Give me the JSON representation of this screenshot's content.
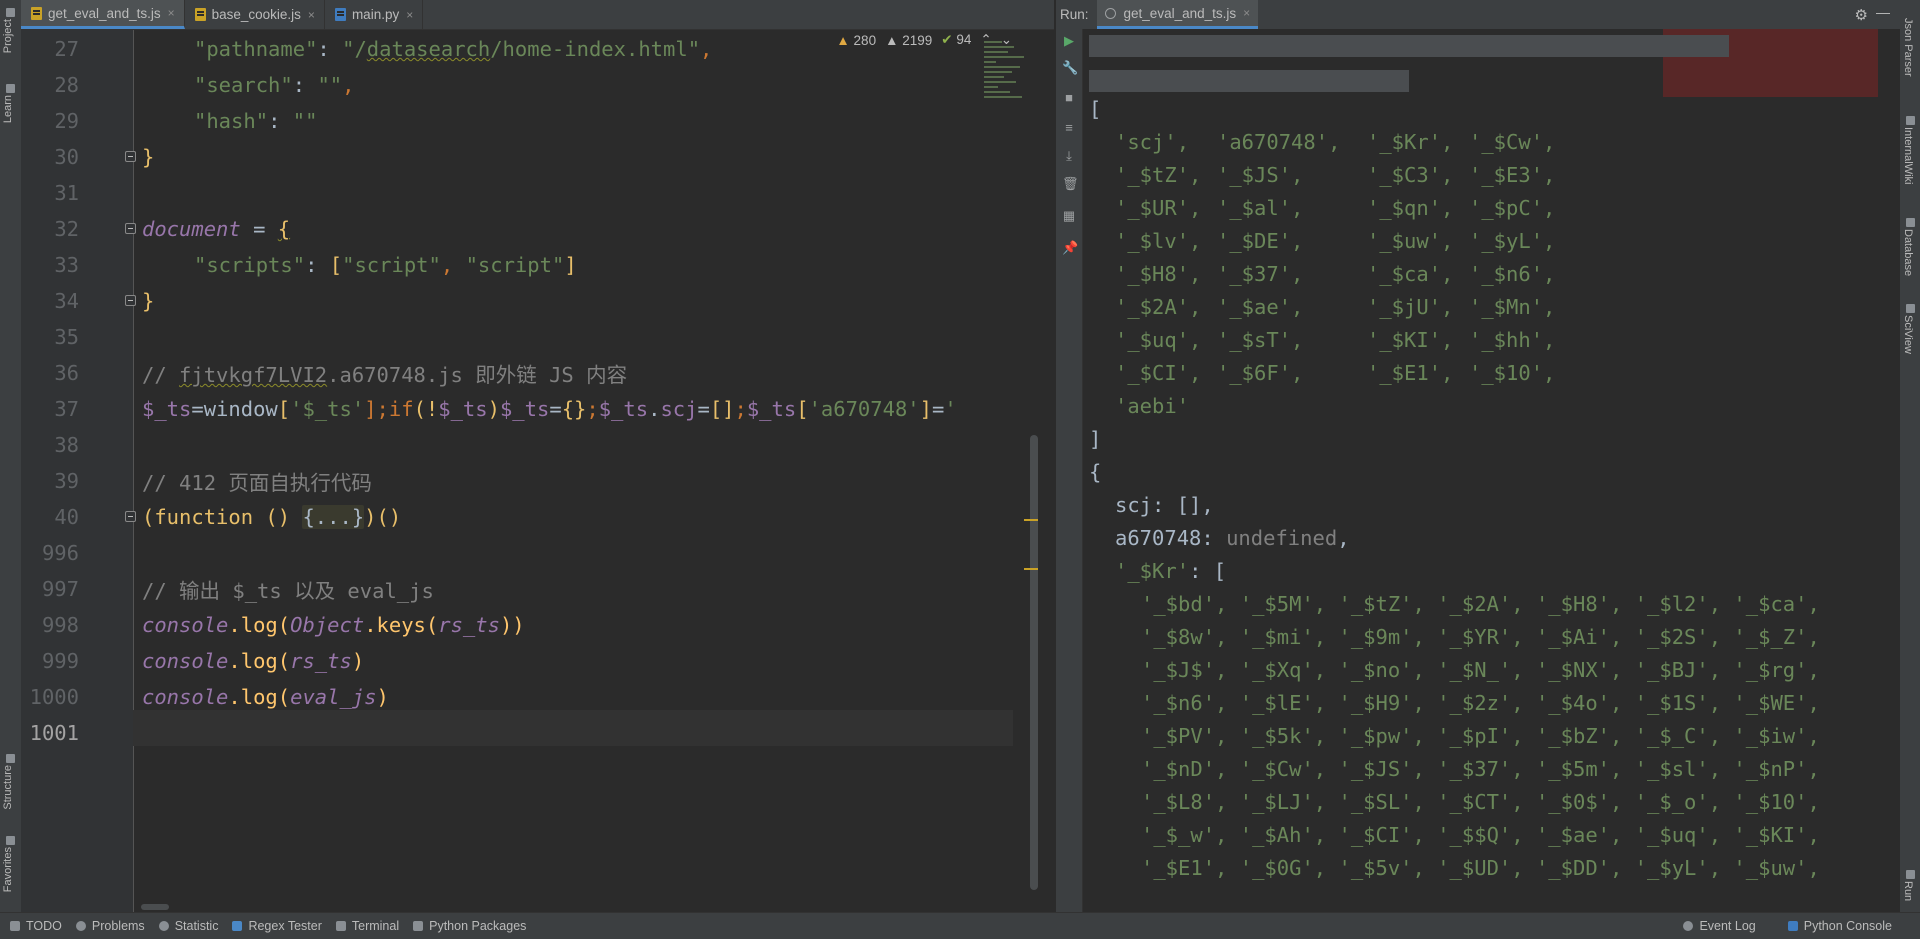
{
  "left_strip": {
    "project": "Project",
    "learn": "Learn",
    "structure": "Structure",
    "favorites": "Favorites"
  },
  "right_strip": {
    "json_parser": "Json Parser",
    "internal_wiki": "InternalWiki",
    "database": "Database",
    "sciview": "SciView",
    "run": "Run"
  },
  "editor_tabs": [
    {
      "label": "get_eval_and_ts.js",
      "icon": "js-file-icon",
      "active": true
    },
    {
      "label": "base_cookie.js",
      "icon": "js-file-icon",
      "active": false
    },
    {
      "label": "main.py",
      "icon": "python-file-icon",
      "active": false
    }
  ],
  "inspections": {
    "warnings": "280",
    "weak_warnings": "2199",
    "typos": "94",
    "up": "⌃",
    "down": "⌄"
  },
  "gutter": {
    "l27": "27",
    "l28": "28",
    "l29": "29",
    "l30": "30",
    "l31": "31",
    "l32": "32",
    "l33": "33",
    "l34": "34",
    "l35": "35",
    "l36": "36",
    "l37": "37",
    "l38": "38",
    "l39": "39",
    "l40": "40",
    "l996": "996",
    "l997": "997",
    "l998": "998",
    "l999": "999",
    "l1000": "1000",
    "l1001": "1001"
  },
  "code": {
    "l27_key": "\"pathname\"",
    "l27_colon": ": ",
    "l27_q1": "\"",
    "l27_path1": "/",
    "l27_path_word": "datasearch",
    "l27_path2": "/home-index.html\"",
    "l27_comma": ",",
    "l28_key": "\"search\"",
    "l28_rest": ": ",
    "l28_val": "\"\"",
    "l28_comma": ",",
    "l29_key": "\"hash\"",
    "l29_rest": ": ",
    "l29_val": "\"\"",
    "l30": "}",
    "l32_doc": "document",
    "l32_eq": " = ",
    "l32_brace": "{",
    "l33_key": "\"scripts\"",
    "l33_colon": ": ",
    "l33_open": "[",
    "l33_s1": "\"script\"",
    "l33_sep": ", ",
    "l33_s2": "\"script\"",
    "l33_close": "]",
    "l34": "}",
    "l36_a": "// ",
    "l36_b": "fjtvkgf7LVI2",
    "l36_c": ".a670748.js 即外链 JS 内容",
    "l37_a": "$_ts",
    "l37_b": "=window",
    "l37_c": "[",
    "l37_d": "'$_ts'",
    "l37_e": "];",
    "l37_f": "if",
    "l37_g": "(!",
    "l37_h": "$_ts",
    "l37_i": ")",
    "l37_j": "$_ts",
    "l37_k": "=",
    "l37_l": "{}",
    "l37_m": ";",
    "l37_n": "$_ts",
    "l37_o": ".",
    "l37_p": "scj",
    "l37_q": "=",
    "l37_r": "[]",
    "l37_s": ";",
    "l37_t": "$_ts",
    "l37_u": "[",
    "l37_v": "'a670748'",
    "l37_w": "]",
    "l37_x": "=",
    "l37_y": "'",
    "l39": "// 412 页面自执行代码",
    "l40_a": "(function ",
    "l40_b": "() ",
    "l40_c": "{...}",
    "l40_d": ")()",
    "l997": "// 输出 $_ts 以及 eval_js",
    "l998_a": "console",
    "l998_b": ".log(",
    "l998_c": "Object",
    "l998_d": ".keys(",
    "l998_e": "rs_ts",
    "l998_f": "))",
    "l999_a": "console",
    "l999_b": ".log(",
    "l999_c": "rs_ts",
    "l999_d": ")",
    "l1000_a": "console",
    "l1000_b": ".log(",
    "l1000_c": "eval_js",
    "l1000_d": ")"
  },
  "run": {
    "title": "Run:",
    "tab": "get_eval_and_ts.js",
    "close": "×",
    "gear": "⚙",
    "minimize": "—"
  },
  "console": {
    "open_bracket": "[",
    "keys_rows": [
      [
        "'scj',",
        "'a670748',",
        "'_$Kr',",
        "'_$Cw',"
      ],
      [
        "'_$tZ',",
        "'_$JS',",
        "'_$C3',",
        "'_$E3',"
      ],
      [
        "'_$UR',",
        "'_$al',",
        "'_$qn',",
        "'_$pC',"
      ],
      [
        "'_$lv',",
        "'_$DE',",
        "'_$uw',",
        "'_$yL',"
      ],
      [
        "'_$H8',",
        "'_$37',",
        "'_$ca',",
        "'_$n6',"
      ],
      [
        "'_$2A',",
        "'_$ae',",
        "'_$jU',",
        "'_$Mn',"
      ],
      [
        "'_$uq',",
        "'_$sT',",
        "'_$KI',",
        "'_$hh',"
      ],
      [
        "'_$CI',",
        "'_$6F',",
        "'_$E1',",
        "'_$10',"
      ]
    ],
    "last_key": "'aebi'",
    "close_bracket": "]",
    "open_brace": "{",
    "scj_key": "scj: ",
    "scj_val": "[],",
    "a67_key": "a670748: ",
    "a67_val": "undefined",
    "a67_comma": ",",
    "kr_key": "'_$Kr'",
    "kr_rest": ": [",
    "kr_rows": [
      "'_$bd', '_$5M', '_$tZ', '_$2A', '_$H8', '_$l2', '_$ca',",
      "'_$8w', '_$mi', '_$9m', '_$YR', '_$Ai', '_$2S', '_$_Z',",
      "'_$J$', '_$Xq', '_$no', '_$N_', '_$NX', '_$BJ', '_$rg',",
      "'_$n6', '_$lE', '_$H9', '_$2z', '_$4o', '_$1S', '_$WE',",
      "'_$PV', '_$5k', '_$pw', '_$pI', '_$bZ', '_$_C', '_$iw',",
      "'_$nD', '_$Cw', '_$JS', '_$37', '_$5m', '_$sl', '_$nP',",
      "'_$L8', '_$LJ', '_$SL', '_$CT', '_$0$', '_$_o', '_$10',",
      "'_$_w', '_$Ah', '_$CI', '_$$Q', '_$ae', '_$uq', '_$KI',",
      "'_$E1', '_$0G', '_$5v', '_$UD', '_$DD', '_$yL', '_$uw',"
    ]
  },
  "bottom": {
    "todo": "TODO",
    "problems": "Problems",
    "statistic": "Statistic",
    "regex": "Regex Tester",
    "terminal": "Terminal",
    "packages": "Python Packages",
    "event_log": "Event Log",
    "python_console": "Python Console"
  },
  "colors": {
    "string": "#6a8759",
    "keyword": "#cc7832",
    "comment": "#808080",
    "function": "#ffc66d",
    "global": "#9876aa",
    "accent": "#4a88c7"
  }
}
